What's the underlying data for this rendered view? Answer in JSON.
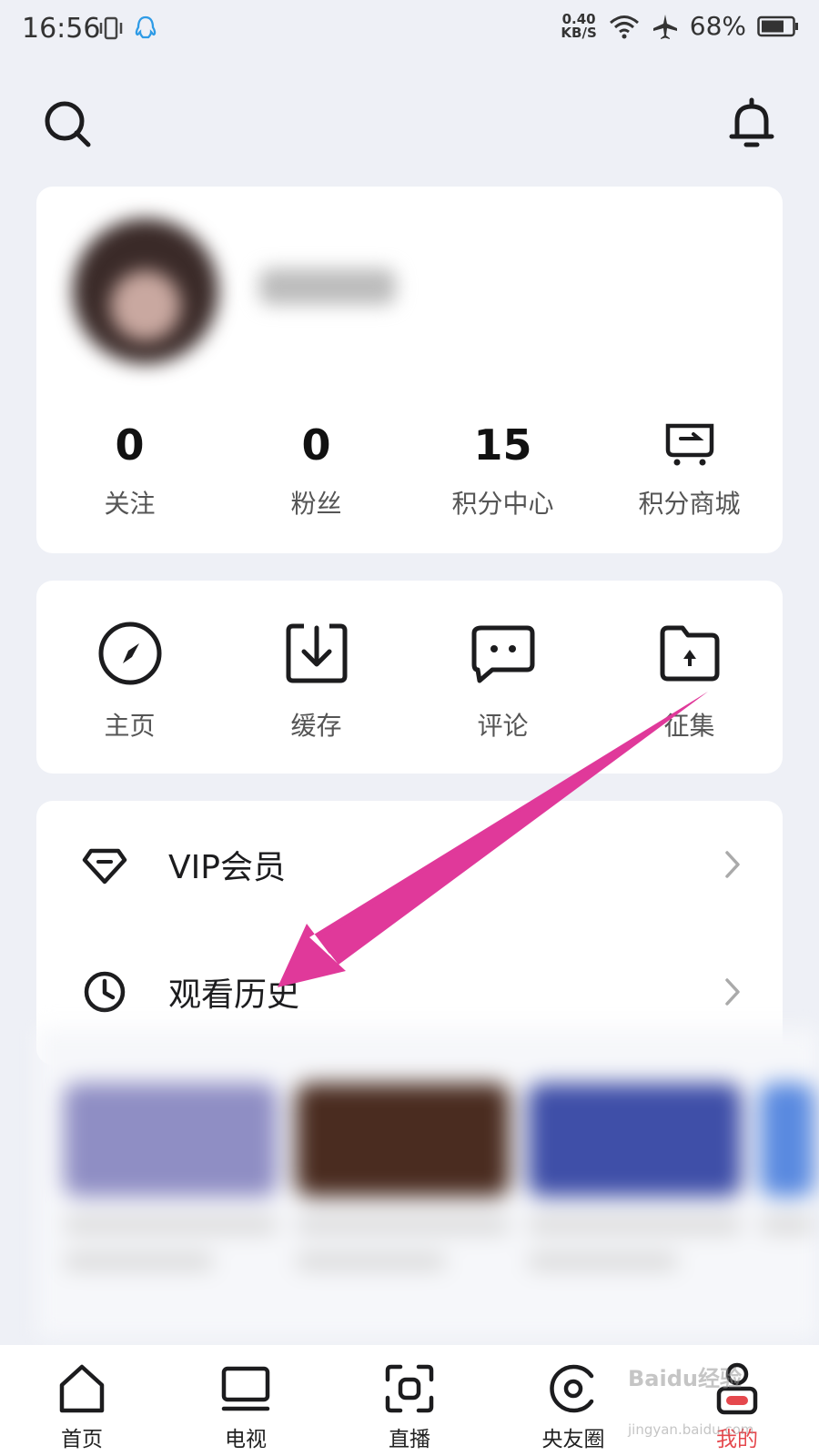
{
  "status_bar": {
    "time": "16:56",
    "net_speed_value": "0.40",
    "net_speed_unit": "KB/S",
    "battery": "68%"
  },
  "header": {
    "search_icon": "search-icon",
    "bell_icon": "bell-icon"
  },
  "profile": {
    "stats": [
      {
        "value": "0",
        "label": "关注"
      },
      {
        "value": "0",
        "label": "粉丝"
      },
      {
        "value": "15",
        "label": "积分中心"
      },
      {
        "label": "积分商城",
        "icon": "cart-icon"
      }
    ]
  },
  "quick_actions": [
    {
      "label": "主页",
      "icon": "compass-icon"
    },
    {
      "label": "缓存",
      "icon": "download-icon"
    },
    {
      "label": "评论",
      "icon": "comment-icon"
    },
    {
      "label": "征集",
      "icon": "folder-upload-icon"
    }
  ],
  "menu": [
    {
      "label": "VIP会员",
      "icon": "diamond-icon"
    },
    {
      "label": "观看历史",
      "icon": "clock-icon"
    }
  ],
  "tab_bar": {
    "items": [
      {
        "label": "首页",
        "icon": "home-icon"
      },
      {
        "label": "电视",
        "icon": "tv-icon"
      },
      {
        "label": "直播",
        "icon": "live-icon"
      },
      {
        "label": "央友圈",
        "icon": "circle-icon"
      },
      {
        "label": "我的",
        "icon": "profile-icon"
      }
    ],
    "active": "我的"
  },
  "watermark": {
    "text": "Baidu经验",
    "sub": "jingyan.baidu.com"
  },
  "colors": {
    "accent": "#e5484d",
    "arrow": "#e0399a",
    "background": "#eef0f6"
  }
}
